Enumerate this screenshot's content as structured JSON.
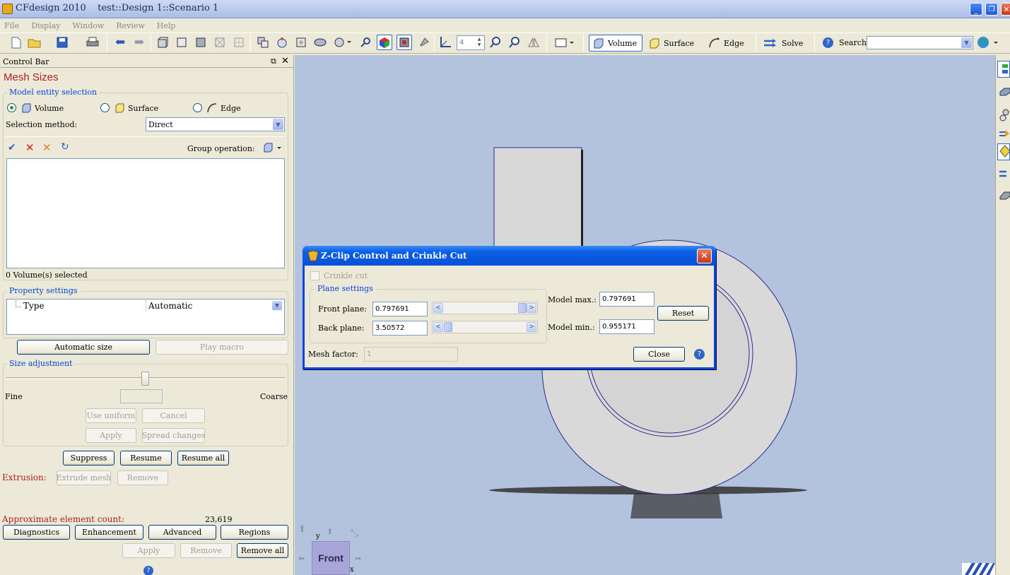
{
  "window": {
    "title": "CFdesign 2010    test::Design 1::Scenario 1"
  },
  "menu": [
    "File",
    "Display",
    "Window",
    "Review",
    "Help"
  ],
  "toolbar": {
    "zoom_value": "4",
    "volume_label": "Volume",
    "surface_label": "Surface",
    "edge_label": "Edge",
    "solve_label": "Solve",
    "search_label": "Search",
    "search_value": ""
  },
  "control_bar": {
    "title": "Control Bar",
    "heading": "Mesh Sizes",
    "model_entity": {
      "legend": "Model entity selection",
      "options": [
        "Volume",
        "Surface",
        "Edge"
      ],
      "selected": "Volume",
      "method_label": "Selection method:",
      "method_value": "Direct",
      "group_label": "Group operation:",
      "status": "0 Volume(s) selected"
    },
    "property": {
      "legend": "Property settings",
      "key": "Type",
      "value": "Automatic"
    },
    "automatic_size": "Automatic size",
    "play_macro": "Play macro",
    "size_adjustment": {
      "legend": "Size adjustment",
      "fine": "Fine",
      "coarse": "Coarse",
      "slider_fraction": 0.5,
      "use_uniform": "Use uniform",
      "cancel": "Cancel",
      "apply": "Apply",
      "spread": "Spread changes"
    },
    "suppress": "Suppress",
    "resume": "Resume",
    "resume_all": "Resume all",
    "extrusion_label": "Extrusion:",
    "extrude_mesh": "Extrude mesh",
    "extrude_remove": "Remove",
    "element_count_label": "Approximate element count:",
    "element_count": "23,619",
    "diagnostics": "Diagnostics",
    "enhancement": "Enhancement",
    "advanced": "Advanced",
    "regions": "Regions",
    "apply": "Apply",
    "remove": "Remove",
    "remove_all": "Remove all"
  },
  "dialog": {
    "title": "Z-Clip Control and Crinkle Cut",
    "crinkle_cut": "Crinkle cut",
    "plane_legend": "Plane settings",
    "front_label": "Front plane:",
    "front_value": "0.797691",
    "back_label": "Back plane:",
    "back_value": "3.50572",
    "model_max_label": "Model max.:",
    "model_max_value": "0.797691",
    "model_min_label": "Model min.:",
    "model_min_value": "0.955171",
    "reset": "Reset",
    "mesh_factor_label": "Mesh factor:",
    "mesh_factor_value": "1",
    "close": "Close"
  },
  "viewcube": {
    "face": "Front",
    "x": "x",
    "y": "y"
  },
  "colors": {
    "viewport": "#b3c3dd",
    "heading": "#b11e1e",
    "accent": "#0046d5",
    "titlebar": "#1660e8"
  }
}
